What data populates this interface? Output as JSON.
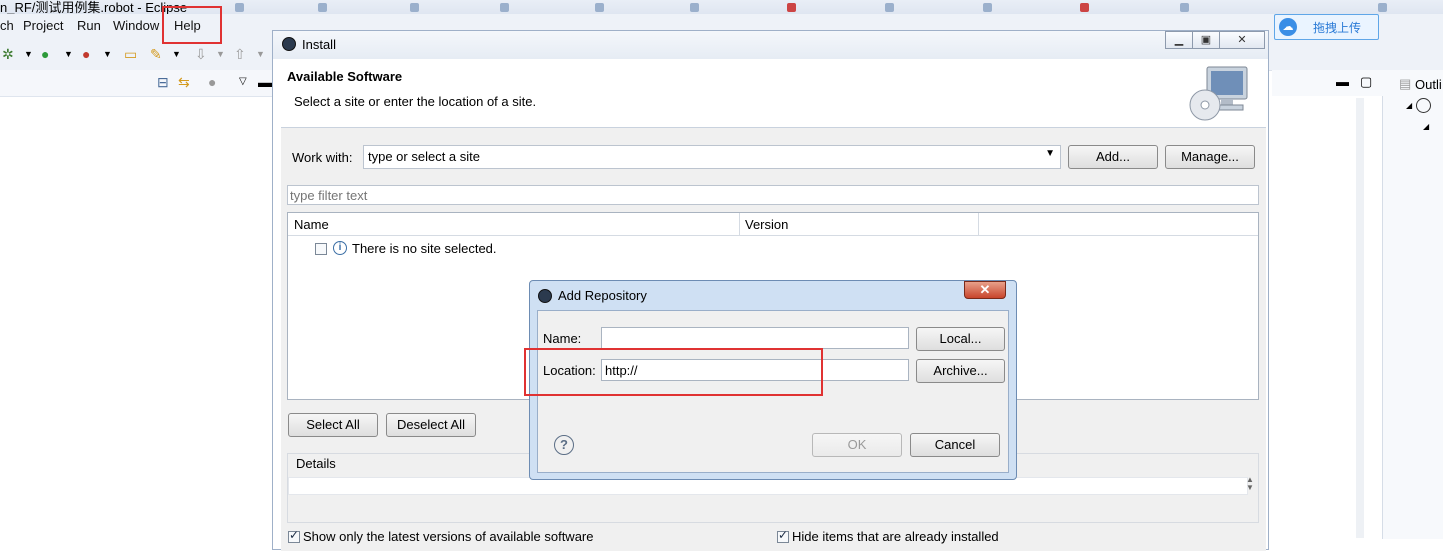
{
  "eclipse": {
    "title": "n_RF/测试用例集.robot - Eclipse",
    "menu": [
      "ch",
      "Project",
      "Run",
      "Window",
      "Help"
    ],
    "upload_button": "拖拽上传"
  },
  "install_dialog": {
    "title": "Install",
    "window_buttons": [
      "minimize",
      "maximize",
      "close"
    ],
    "header_title": "Available Software",
    "header_subtitle": "Select a site or enter the location of a site.",
    "work_with_label": "Work with:",
    "work_with_value": "type or select a site",
    "add_button": "Add...",
    "manage_button": "Manage...",
    "filter_placeholder": "type filter text",
    "columns": [
      "Name",
      "Version"
    ],
    "empty_message": "There is no site selected.",
    "select_all_button": "Select All",
    "deselect_all_button": "Deselect All",
    "details_label": "Details",
    "show_latest_checkbox": "Show only the latest versions of available software",
    "hide_installed_checkbox": "Hide items that are already installed"
  },
  "add_repository_dialog": {
    "title": "Add Repository",
    "name_label": "Name:",
    "name_value": "",
    "local_button": "Local...",
    "location_label": "Location:",
    "location_value": "http://",
    "archive_button": "Archive...",
    "ok_button": "OK",
    "cancel_button": "Cancel"
  },
  "outline": {
    "title": "Outli"
  },
  "colors": {
    "highlight_red": "#e03232",
    "dialog_border_blue": "#6d8cb3"
  }
}
